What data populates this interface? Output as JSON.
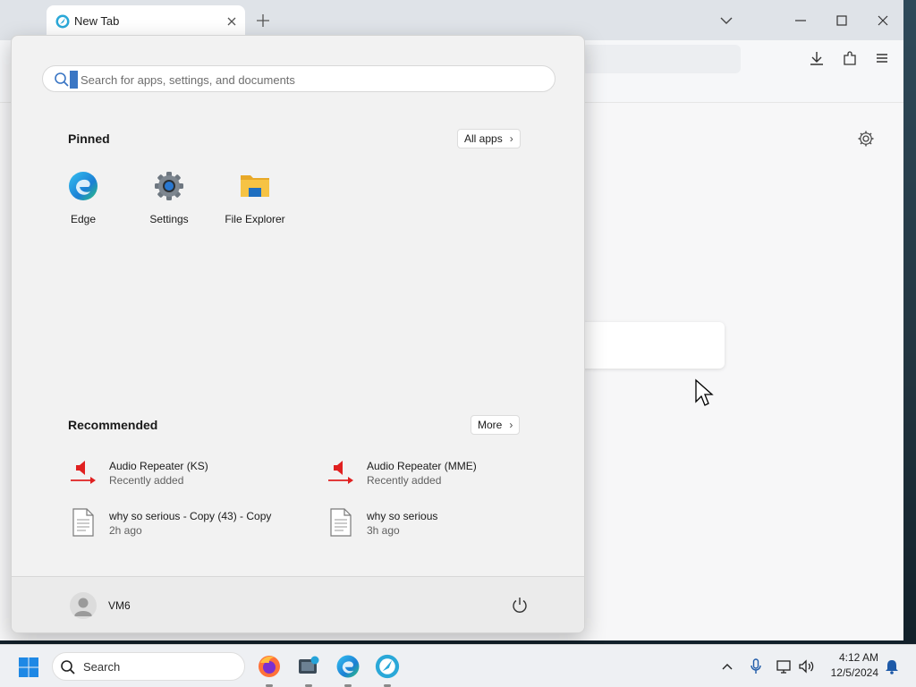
{
  "browser": {
    "tab": {
      "title": "New Tab",
      "icon": "browser-logo-icon"
    },
    "buttons": {
      "new_tab": "plus-icon",
      "tab_list": "chevron-down-icon",
      "minimize": "minimize-icon",
      "maximize": "maximize-icon",
      "close": "close-icon"
    },
    "toolbar_icons": [
      "download-icon",
      "extensions-icon",
      "menu-icon"
    ],
    "page_icons": [
      "gear-icon"
    ]
  },
  "start_menu": {
    "search": {
      "placeholder": "Search for apps, settings, and documents",
      "value": ""
    },
    "pinned": {
      "title": "Pinned",
      "all_apps_label": "All apps",
      "apps": [
        {
          "label": "Edge",
          "icon": "edge-icon"
        },
        {
          "label": "Settings",
          "icon": "settings-gear-icon"
        },
        {
          "label": "File Explorer",
          "icon": "folder-icon"
        }
      ]
    },
    "recommended": {
      "title": "Recommended",
      "more_label": "More",
      "items": [
        {
          "name": "Audio Repeater (KS)",
          "sub": "Recently added",
          "icon": "audio-repeater-icon"
        },
        {
          "name": "Audio Repeater (MME)",
          "sub": "Recently added",
          "icon": "audio-repeater-icon"
        },
        {
          "name": "why so serious - Copy (43) - Copy",
          "sub": "2h ago",
          "icon": "document-icon"
        },
        {
          "name": "why so serious",
          "sub": "3h ago",
          "icon": "document-icon"
        }
      ]
    },
    "user": {
      "name": "VM6"
    }
  },
  "taskbar": {
    "search_label": "Search",
    "apps": [
      "firefox-icon",
      "app-icon",
      "edge-icon",
      "browser-logo-icon"
    ],
    "tray_icons": [
      "chevron-up-icon",
      "microphone-icon",
      "network-icon",
      "volume-icon"
    ],
    "clock": {
      "time": "4:12 AM",
      "date": "12/5/2024"
    }
  },
  "colors": {
    "accent": "#0078d4",
    "audio_red": "#e02020",
    "folder_yellow": "#f6c344"
  }
}
